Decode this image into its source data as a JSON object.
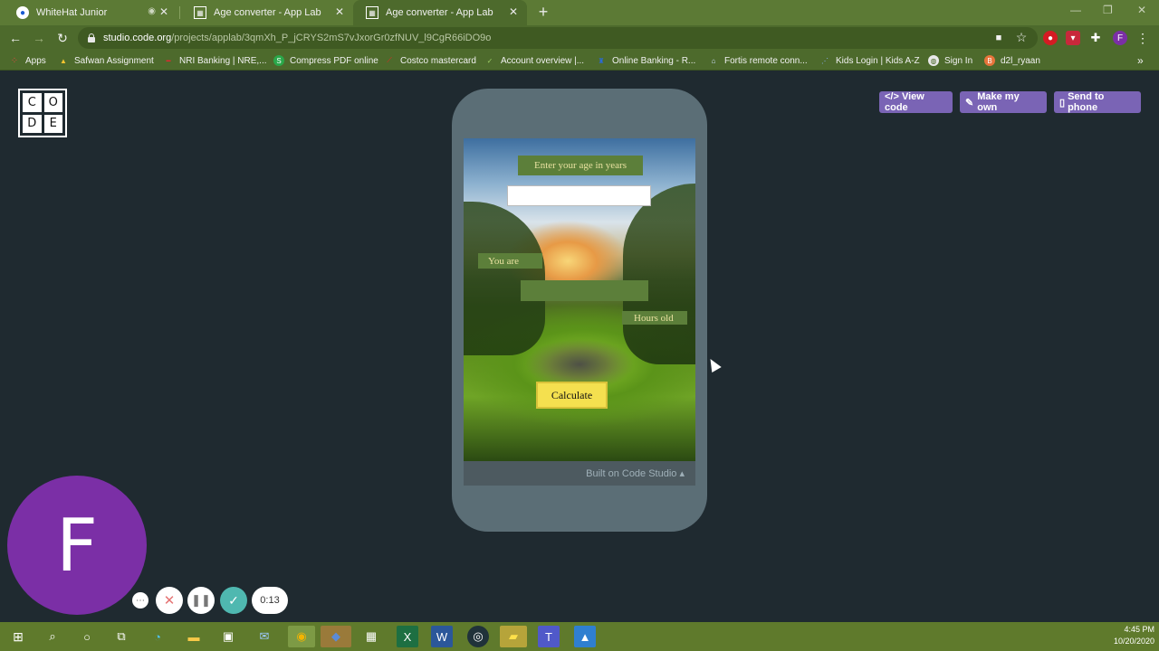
{
  "browser": {
    "tabs": [
      {
        "title": "WhiteHat Junior"
      },
      {
        "title": "Age converter - App Lab"
      },
      {
        "title": "Age converter - App Lab"
      }
    ],
    "url_host": "studio.code.org",
    "url_path": "/projects/applab/3qmXh_P_jCRYS2mS7vJxorGr0zfNUV_l9CgR66iDO9o",
    "bookmarks": [
      {
        "label": "Apps"
      },
      {
        "label": "Safwan Assignment"
      },
      {
        "label": "NRI Banking | NRE,..."
      },
      {
        "label": "Compress PDF online"
      },
      {
        "label": "Costco mastercard"
      },
      {
        "label": "Account overview |..."
      },
      {
        "label": "Online Banking - R..."
      },
      {
        "label": "Fortis remote conn..."
      },
      {
        "label": "Kids Login | Kids A-Z"
      },
      {
        "label": "Sign In"
      },
      {
        "label": "d2l_ryaan"
      }
    ],
    "profile_initial": "F"
  },
  "page": {
    "logo_letters": [
      "C",
      "O",
      "D",
      "E"
    ],
    "buttons": {
      "view_code": "</> View code",
      "make_my_own": "Make my own",
      "send_to_phone": "Send to phone"
    },
    "app": {
      "prompt_label": "Enter your age in years",
      "age_input_value": "",
      "you_are_label": "You are",
      "result_value": "",
      "hours_old_label": "Hours old",
      "calculate_label": "Calculate"
    },
    "built_on": "Built on Code Studio ▴"
  },
  "recorder": {
    "avatar_initial": "F",
    "timer": "0:13"
  },
  "taskbar": {
    "time": "4:45 PM",
    "date": "10/20/2020"
  },
  "colors": {
    "chrome_green": "#5c7a35",
    "page_bg": "#1f2a30",
    "button_purple": "#7a64b5",
    "phone_frame": "#5b6e76",
    "app_label_bg": "#5c7f3a",
    "calculate_yellow": "#f4e04f",
    "avatar_purple": "#7b2fa6"
  }
}
